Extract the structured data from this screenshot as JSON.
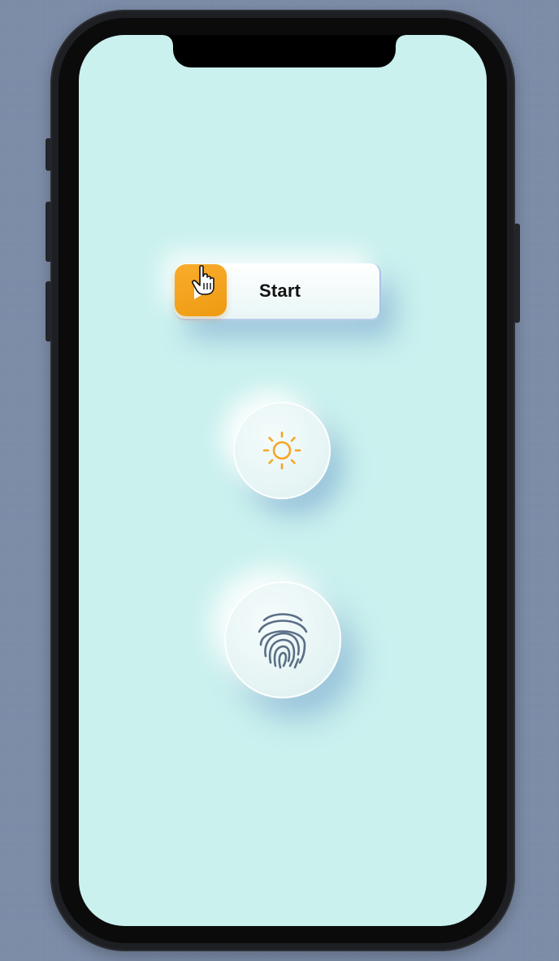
{
  "device": {
    "model": "phone-mockup"
  },
  "start_button": {
    "label": "Start",
    "icon": "play-icon",
    "accent_color": "#f5a623"
  },
  "sun_button": {
    "icon": "sun-icon",
    "icon_color": "#f5a623"
  },
  "fingerprint_button": {
    "icon": "fingerprint-icon",
    "icon_color": "#5a6f86"
  },
  "colors": {
    "screen_background": "#caf1ee",
    "outer_background": "#7a8aa6",
    "shadow_blue": "#5c8cc4"
  },
  "cursor": {
    "icon": "hand-pointer-icon"
  }
}
